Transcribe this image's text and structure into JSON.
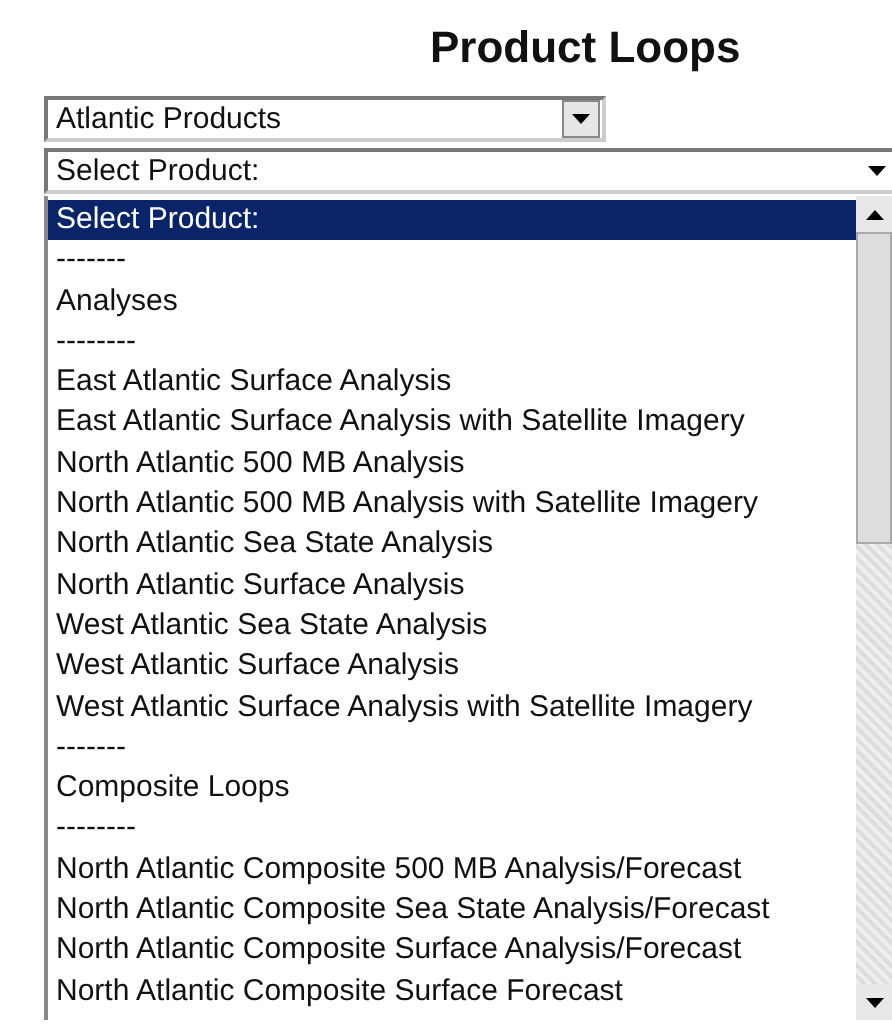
{
  "title": "Product Loops",
  "region_select": {
    "value": "Atlantic Products"
  },
  "product_select": {
    "value": "Select Product:"
  },
  "product_list": [
    {
      "label": "Select Product:",
      "selected": true
    },
    {
      "label": "-------",
      "selected": false
    },
    {
      "label": "Analyses",
      "selected": false
    },
    {
      "label": "--------",
      "selected": false
    },
    {
      "label": "East Atlantic Surface Analysis",
      "selected": false
    },
    {
      "label": "East Atlantic Surface Analysis with Satellite Imagery",
      "selected": false
    },
    {
      "label": "North Atlantic 500 MB Analysis",
      "selected": false
    },
    {
      "label": "North Atlantic 500 MB Analysis with Satellite Imagery",
      "selected": false
    },
    {
      "label": "North Atlantic Sea State Analysis",
      "selected": false
    },
    {
      "label": "North Atlantic Surface Analysis",
      "selected": false
    },
    {
      "label": "West Atlantic Sea State Analysis",
      "selected": false
    },
    {
      "label": "West Atlantic Surface Analysis",
      "selected": false
    },
    {
      "label": "West Atlantic Surface Analysis with Satellite Imagery",
      "selected": false
    },
    {
      "label": "-------",
      "selected": false
    },
    {
      "label": "Composite Loops",
      "selected": false
    },
    {
      "label": "--------",
      "selected": false
    },
    {
      "label": "North Atlantic Composite 500 MB Analysis/Forecast",
      "selected": false
    },
    {
      "label": "North Atlantic Composite Sea State Analysis/Forecast",
      "selected": false
    },
    {
      "label": "North Atlantic Composite Surface Analysis/Forecast",
      "selected": false
    },
    {
      "label": "North Atlantic Composite Surface Forecast",
      "selected": false
    }
  ]
}
